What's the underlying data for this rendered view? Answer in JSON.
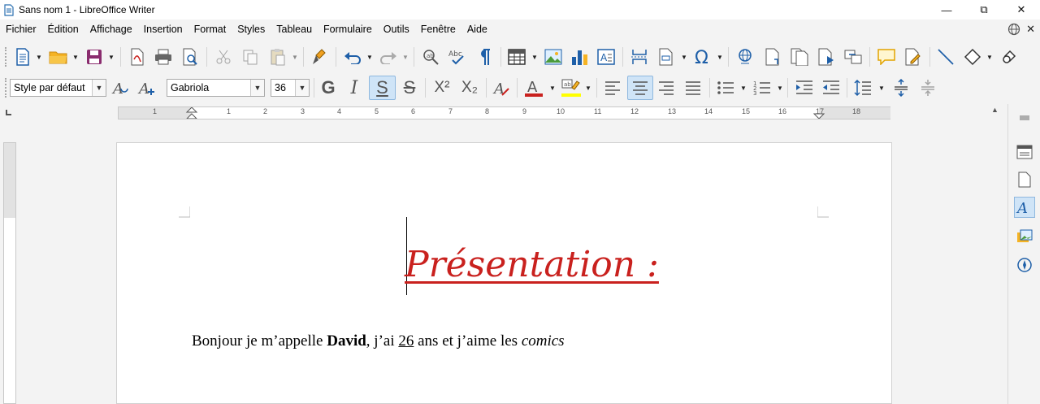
{
  "window": {
    "title": "Sans nom 1 - LibreOffice Writer"
  },
  "menu": {
    "items": [
      "Fichier",
      "Édition",
      "Affichage",
      "Insertion",
      "Format",
      "Styles",
      "Tableau",
      "Formulaire",
      "Outils",
      "Fenêtre",
      "Aide"
    ]
  },
  "formatting": {
    "paragraph_style": "Style par défaut",
    "font_name": "Gabriola",
    "font_size": "36",
    "bold_label": "G",
    "italic_label": "I",
    "underline_label": "S",
    "strike_label": "S",
    "superscript_label": "X²",
    "subscript_label": "X₂"
  },
  "ruler": {
    "h_labels": [
      "1",
      "1",
      "2",
      "3",
      "4",
      "5",
      "6",
      "7",
      "8",
      "9",
      "10",
      "11",
      "12",
      "13",
      "14",
      "15",
      "16",
      "17",
      "18"
    ]
  },
  "document": {
    "title": "Présentation :",
    "body_part1": "Bonjour je m’appelle ",
    "body_name": "David",
    "body_part2": ", j’ai ",
    "body_age": "26",
    "body_part3": " ans et j’aime les ",
    "body_part4": "comics"
  },
  "colors": {
    "title_color": "#c9211e",
    "font_color_bar": "#c9211e",
    "highlight_bar": "#ffff00",
    "accent": "#2a6fb0"
  }
}
